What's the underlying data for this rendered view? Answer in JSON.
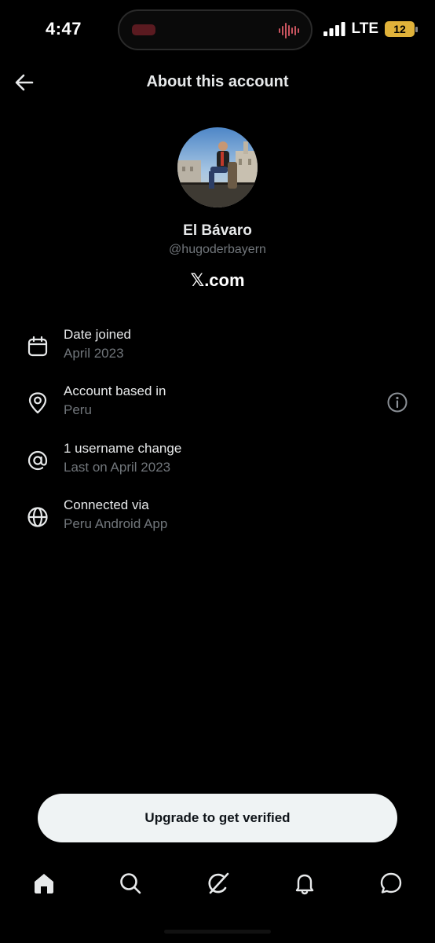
{
  "status_bar": {
    "time": "4:47",
    "network": "LTE",
    "battery": "12"
  },
  "header": {
    "title": "About this account",
    "back_icon": "arrow-left-icon"
  },
  "profile": {
    "display_name": "El Bávaro",
    "handle": "@hugoderbayern",
    "site_prefix": "𝕏",
    "site_suffix": ".com"
  },
  "info": [
    {
      "icon": "calendar-icon",
      "label": "Date joined",
      "value": "April 2023"
    },
    {
      "icon": "location-pin-icon",
      "label": "Account based in",
      "value": "Peru",
      "more_icon": "info-icon"
    },
    {
      "icon": "at-sign-icon",
      "label": "1 username change",
      "value": "Last on April 2023"
    },
    {
      "icon": "globe-icon",
      "label": "Connected via",
      "value": "Peru Android App"
    }
  ],
  "upgrade_button": "Upgrade to get verified",
  "nav": [
    "home-icon",
    "search-icon",
    "grok-icon",
    "notifications-bell-icon",
    "messages-icon"
  ],
  "colors": {
    "background": "#000000",
    "primary_text": "#e7e9ea",
    "secondary_text": "#71767b",
    "button_bg": "#eff3f4",
    "battery": "#e0b23a"
  }
}
